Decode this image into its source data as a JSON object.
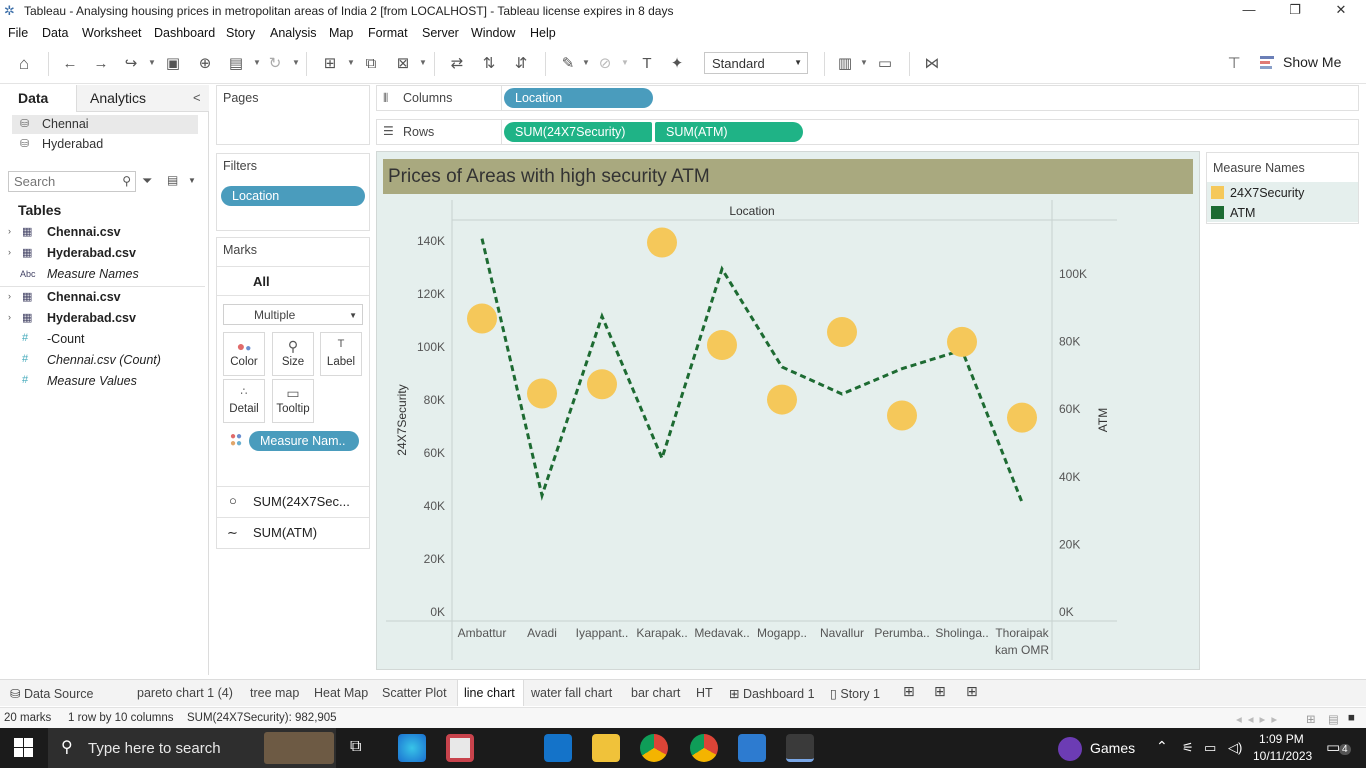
{
  "window": {
    "title": "Tableau - Analysing housing prices in metropolitan areas of India 2 [from LOCALHOST] - Tableau license expires in 8 days",
    "minimize": "—",
    "restore": "❐",
    "close": "✕"
  },
  "menu": [
    "File",
    "Data",
    "Worksheet",
    "Dashboard",
    "Story",
    "Analysis",
    "Map",
    "Format",
    "Server",
    "Window",
    "Help"
  ],
  "toolbar": {
    "fit_select": "Standard",
    "show_me": "Show Me"
  },
  "data_pane": {
    "tabs": [
      "Data",
      "Analytics"
    ],
    "collapse": "<",
    "datasources": [
      "Chennai",
      "Hyderabad"
    ],
    "search_placeholder": "Search",
    "tables_heading": "Tables",
    "fields": [
      {
        "name": "Chennai.csv",
        "type": "table",
        "expand": "›"
      },
      {
        "name": "Hyderabad.csv",
        "type": "table",
        "expand": "›"
      },
      {
        "name": "Measure Names",
        "type": "abc"
      },
      {
        "name": "Chennai.csv",
        "type": "table",
        "expand": "›"
      },
      {
        "name": "Hyderabad.csv",
        "type": "table",
        "expand": "›"
      },
      {
        "name": "-Count",
        "type": "measure"
      },
      {
        "name": "Chennai.csv (Count)",
        "type": "measure"
      },
      {
        "name": "Measure Values",
        "type": "measure"
      }
    ]
  },
  "shelves": {
    "pages": "Pages",
    "filters": "Filters",
    "filter_pill": "Location",
    "marks": "Marks",
    "marks_all": "All",
    "mark_type": "Multiple",
    "mark_buttons": [
      "Color",
      "Size",
      "Label",
      "Detail",
      "Tooltip"
    ],
    "color_pill": "Measure Nam..",
    "marks_cards": [
      "SUM(24X7Sec...",
      "SUM(ATM)"
    ],
    "columns_label": "Columns",
    "columns_pill": "Location",
    "rows_label": "Rows",
    "rows_pills": [
      "SUM(24X7Security)",
      "SUM(ATM)"
    ]
  },
  "legend": {
    "title": "Measure Names",
    "items": [
      {
        "name": "24X7Security",
        "color": "#f5c85a"
      },
      {
        "name": "ATM",
        "color": "#1d6b32"
      }
    ]
  },
  "chart_data": {
    "type": "scatter",
    "title": "Prices of Areas with high security ATM",
    "header": "Location",
    "categories": [
      "Ambattur",
      "Avadi",
      "Iyappant..",
      "Karapak..",
      "Medavak..",
      "Mogapp..",
      "Navallur",
      "Perumba..",
      "Sholinga..",
      "Thoraipak kam OMR"
    ],
    "category_lines": [
      [
        "Ambattur"
      ],
      [
        "Avadi"
      ],
      [
        "Iyappant.."
      ],
      [
        "Karapak.."
      ],
      [
        "Medavak.."
      ],
      [
        "Mogapp.."
      ],
      [
        "Navallur"
      ],
      [
        "Perumba.."
      ],
      [
        "Sholinga.."
      ],
      [
        "Thoraipak",
        "kam OMR"
      ]
    ],
    "y_left": {
      "label": "24X7Security",
      "ticks": [
        "0K",
        "20K",
        "40K",
        "60K",
        "80K",
        "100K",
        "120K",
        "140K"
      ],
      "range": [
        0,
        148000
      ]
    },
    "y_right": {
      "label": "ATM",
      "ticks": [
        "0K",
        "20K",
        "40K",
        "60K",
        "80K",
        "100K"
      ],
      "range": [
        0,
        116000
      ]
    },
    "series": [
      {
        "name": "24X7Security",
        "mark": "circle",
        "color": "#f5c85a",
        "values": [
          110800,
          82500,
          86000,
          139500,
          100800,
          80200,
          105700,
          74200,
          102000,
          73400
        ]
      },
      {
        "name": "ATM",
        "mark": "dashed-line",
        "color": "#1d6b32",
        "values": [
          110500,
          34500,
          87500,
          45500,
          101500,
          72500,
          64500,
          72000,
          77500,
          32500
        ]
      }
    ]
  },
  "sheet_tabs": [
    "Data Source",
    "pareto chart 1 (4)",
    "tree map",
    "Heat Map",
    "Scatter Plot",
    "line chart",
    "water fall chart",
    "bar chart",
    "HT",
    "Dashboard 1",
    "Story 1"
  ],
  "active_tab": "line chart",
  "status": {
    "marks": "20 marks",
    "dims": "1 row by 10 columns",
    "sum": "SUM(24X7Security): 982,905"
  },
  "taskbar": {
    "search": "Type here to search",
    "games": "Games",
    "time": "1:09 PM",
    "date": "10/11/2023",
    "notifications": "4"
  }
}
